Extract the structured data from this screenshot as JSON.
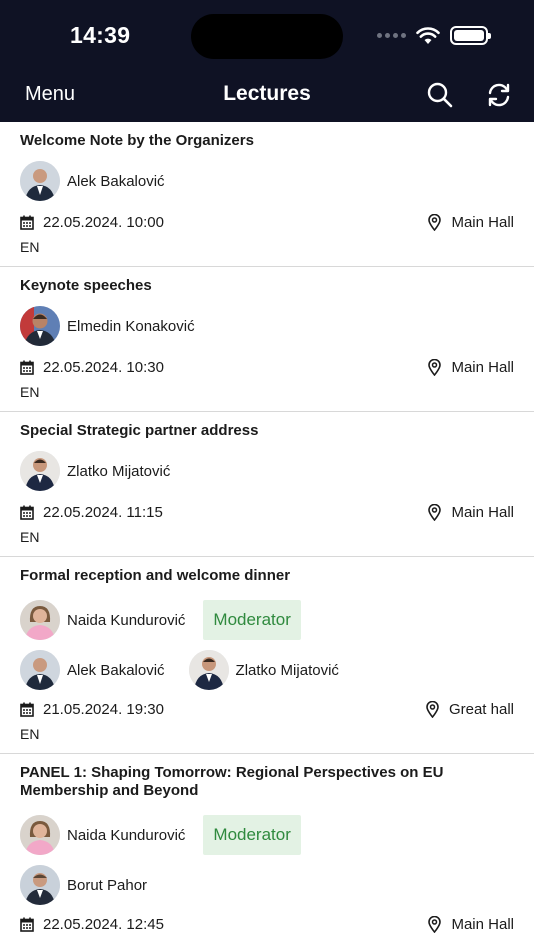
{
  "status_bar": {
    "time": "14:39"
  },
  "nav": {
    "menu_label": "Menu",
    "title": "Lectures"
  },
  "lectures": [
    {
      "title": "Welcome Note by the Organizers",
      "speakers": [
        {
          "name": "Alek Bakalović"
        }
      ],
      "date": "22.05.2024. 10:00",
      "location": "Main Hall",
      "language": "EN"
    },
    {
      "title": "Keynote speeches",
      "speakers": [
        {
          "name": "Elmedin Konaković"
        }
      ],
      "date": "22.05.2024. 10:30",
      "location": "Main Hall",
      "language": "EN"
    },
    {
      "title": "Special Strategic partner address",
      "speakers": [
        {
          "name": "Zlatko Mijatović"
        }
      ],
      "date": "22.05.2024. 11:15",
      "location": "Main Hall",
      "language": "EN"
    },
    {
      "title": "Formal reception and welcome dinner",
      "moderator": {
        "name": "Naida Kundurović",
        "badge": "Moderator"
      },
      "speakers": [
        {
          "name": "Alek Bakalović"
        },
        {
          "name": "Zlatko Mijatović"
        }
      ],
      "date": "21.05.2024. 19:30",
      "location": "Great hall",
      "language": "EN"
    },
    {
      "title": "PANEL 1: Shaping Tomorrow: Regional Perspectives on EU Membership and Beyond",
      "moderator": {
        "name": "Naida Kundurović",
        "badge": "Moderator"
      },
      "speakers": [
        {
          "name": "Borut Pahor"
        }
      ],
      "date": "22.05.2024. 12:45",
      "location": "Main Hall"
    }
  ],
  "colors": {
    "header_bg": "#0f1224",
    "moderator_bg": "#e3f2e4",
    "moderator_text": "#2f8a3e"
  },
  "icons": [
    "search-icon",
    "refresh-icon",
    "calendar-icon",
    "location-pin-icon",
    "wifi-icon",
    "battery-icon"
  ]
}
